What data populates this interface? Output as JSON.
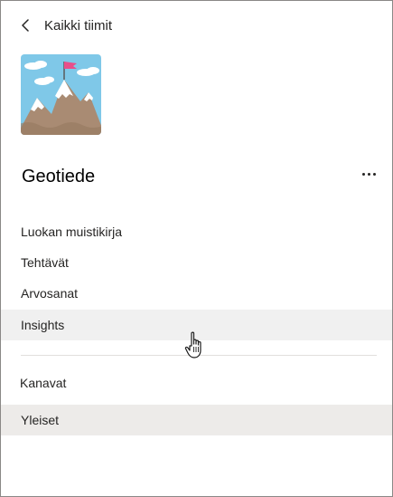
{
  "header": {
    "back_label": "Kaikki tiimit",
    "back_icon": "chevron-left-icon"
  },
  "team": {
    "name": "Geotiede",
    "avatar_icon": "mountain-flag-icon",
    "more_icon": "more-options-icon"
  },
  "nav": {
    "items": [
      {
        "label": "Luokan muistikirja"
      },
      {
        "label": "Tehtävät"
      },
      {
        "label": "Arvosanat"
      },
      {
        "label": "Insights",
        "active": true
      }
    ]
  },
  "channels": {
    "header": "Kanavat",
    "items": [
      {
        "label": "Yleiset"
      }
    ]
  },
  "colors": {
    "sky": "#7fc8e8",
    "mountain": "#a98b73",
    "snow": "#ffffff",
    "flag": "#e94e8a",
    "active_bg": "#f0f0f0",
    "channel_bg": "#edebe9"
  }
}
